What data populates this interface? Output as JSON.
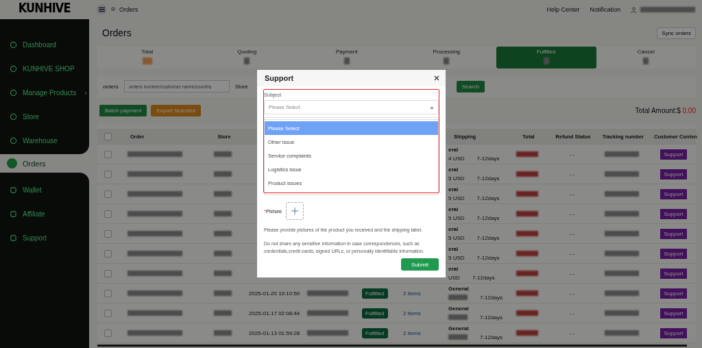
{
  "logo": "KUNHIVE",
  "sidebar": {
    "items": [
      {
        "label": "Dashboard",
        "selected": false
      },
      {
        "label": "KUNHIVE SHOP",
        "selected": false
      },
      {
        "label": "Manage Products",
        "selected": false,
        "chevron": "›"
      },
      {
        "label": "Store",
        "selected": false
      },
      {
        "label": "Warehouse",
        "selected": false
      },
      {
        "label": "Orders",
        "selected": true
      },
      {
        "label": "Wallet",
        "selected": false
      },
      {
        "label": "Affiliate",
        "selected": false
      },
      {
        "label": "Support",
        "selected": false
      }
    ]
  },
  "topbar": {
    "breadcrumb": "Orders",
    "links": [
      "Help Center",
      "Notification"
    ]
  },
  "page": {
    "title": "Orders",
    "sync_button": "Sync orders"
  },
  "status_tabs": [
    {
      "label": "Total",
      "selected": false
    },
    {
      "label": "Quoting",
      "selected": false
    },
    {
      "label": "Payment",
      "selected": false
    },
    {
      "label": "Processing",
      "selected": false
    },
    {
      "label": "Fulfilled",
      "selected": true
    },
    {
      "label": "Cancel",
      "selected": false
    }
  ],
  "filter": {
    "orders_label": "orders",
    "placeholder": "orders number/customer name/country",
    "store_label": "Store",
    "search_button": "Search"
  },
  "actions": [
    {
      "label": "Batch payment",
      "kind": "primary"
    },
    {
      "label": "Export Selected",
      "kind": "warning"
    }
  ],
  "total_amount": {
    "label": "Total Amount:$",
    "value": "0.00"
  },
  "table": {
    "all_checked": false,
    "columns": {
      "order": "Order",
      "store": "Store",
      "shipping": "Shipping",
      "total": "Total",
      "refund": "Refund Status",
      "tracking": "Tracking number",
      "customer": "Customer Conten"
    },
    "rows": [
      {
        "checked": false,
        "shipping": "eral",
        "price": "4 USD",
        "delivery": "7-12days",
        "refund": "- -",
        "action": "Support"
      },
      {
        "checked": false,
        "shipping": "eral",
        "price": "5 USD",
        "delivery": "7-12days",
        "refund": "- -",
        "action": "Support"
      },
      {
        "checked": false,
        "shipping": "eral",
        "price": "5 USD",
        "delivery": "7-12days",
        "refund": "- -",
        "action": "Support"
      },
      {
        "checked": false,
        "shipping": "eral",
        "price": "5 USD",
        "delivery": "7-12days",
        "refund": "- -",
        "action": "Support"
      },
      {
        "checked": false,
        "shipping": "eral",
        "price": "5 USD",
        "delivery": "7-12days",
        "refund": "- -",
        "action": "Support"
      },
      {
        "checked": false,
        "shipping": "eral",
        "price": "5 USD",
        "delivery": "7-12days",
        "refund": "- -",
        "action": "Support"
      },
      {
        "checked": false,
        "shipping": "eral",
        "price": "USD",
        "delivery": "7-12days",
        "refund": "- -",
        "action": "Support"
      },
      {
        "checked": false,
        "date": "2025-01-20 19:10:50",
        "status": "Fulfilled",
        "items": "2 items",
        "shipping": "General",
        "delivery": "7-12days",
        "refund": "- -",
        "action": "Support"
      },
      {
        "checked": false,
        "date": "2025-01-17 02:08:44",
        "status": "Fulfilled",
        "items": "2 items",
        "shipping": "General",
        "delivery": "7-12days",
        "refund": "- -",
        "action": "Support"
      },
      {
        "checked": false,
        "date": "2025-01-13 01:59:28",
        "status": "Fulfilled",
        "items": "2 items",
        "shipping": "General",
        "delivery": "7-12days",
        "refund": "- -",
        "action": "Support"
      }
    ]
  },
  "modal": {
    "title": "Support",
    "subject_label": "Subject",
    "select_placeholder": "Please Select",
    "options": [
      {
        "label": "Please Select",
        "selected": true
      },
      {
        "label": "Other issue",
        "selected": false
      },
      {
        "label": "Service complaints",
        "selected": false
      },
      {
        "label": "Logistics issue",
        "selected": false
      },
      {
        "label": "Product issues",
        "selected": false
      }
    ],
    "required_mark": "*",
    "picture_label": "Picture",
    "notes": [
      "Please provide pictures of the product you received and the shipping label.",
      "Do not share any sensitive information in case correspondences, such as credentials,credit cards, signed URLs, or personally identifiable information."
    ],
    "submit": "Submit"
  }
}
